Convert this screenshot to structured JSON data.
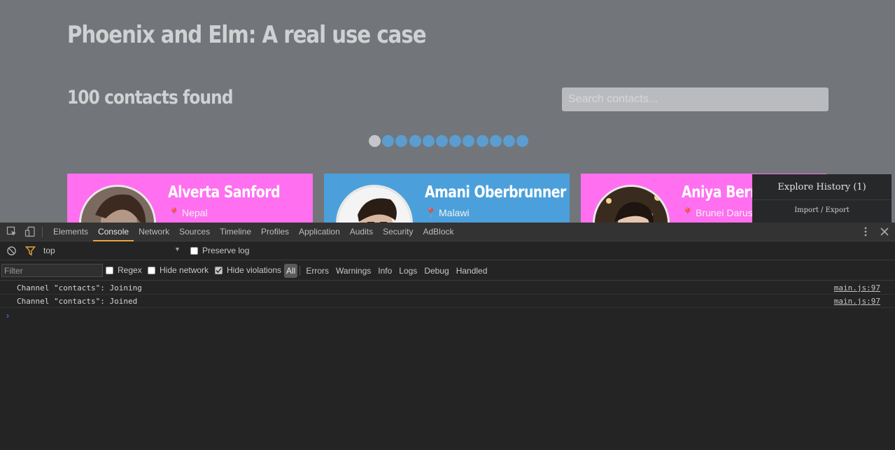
{
  "page": {
    "title": "Phoenix and Elm: A real use case",
    "count_title": "100 contacts found",
    "search_placeholder": "Search contacts...",
    "pagination": {
      "pages": 12,
      "active_page": 1
    },
    "cards": [
      {
        "name": "Alverta Sanford",
        "location": "Nepal",
        "color": "#ff6ff0"
      },
      {
        "name": "Amani Oberbrunner",
        "location": "Malawi",
        "color": "#4ba0db"
      },
      {
        "name": "Aniya Bernier",
        "location": "Brunei Darussalam",
        "color": "#ff6ff0"
      }
    ]
  },
  "explore_history": {
    "title": "Explore History (1)",
    "link": "Import / Export"
  },
  "devtools": {
    "tabs": [
      "Elements",
      "Console",
      "Network",
      "Sources",
      "Timeline",
      "Profiles",
      "Application",
      "Audits",
      "Security",
      "AdBlock"
    ],
    "active_tab": "Console",
    "context": "top",
    "preserve_log": "Preserve log",
    "filter_placeholder": "Filter",
    "regex": "Regex",
    "hide_network": "Hide network",
    "hide_violations": "Hide violations",
    "levels": [
      "All",
      "Errors",
      "Warnings",
      "Info",
      "Logs",
      "Debug",
      "Handled"
    ],
    "active_level": "All",
    "logs": [
      {
        "message": "Channel \"contacts\": Joining",
        "source": "main.js:97"
      },
      {
        "message": "Channel \"contacts\": Joined",
        "source": "main.js:97"
      }
    ],
    "prompt": "›"
  },
  "colors": {
    "accent": "#e8a33d",
    "pagination_dot": "#5b9dd0",
    "card_pink": "#ff6ff0",
    "card_blue": "#4ba0db"
  }
}
